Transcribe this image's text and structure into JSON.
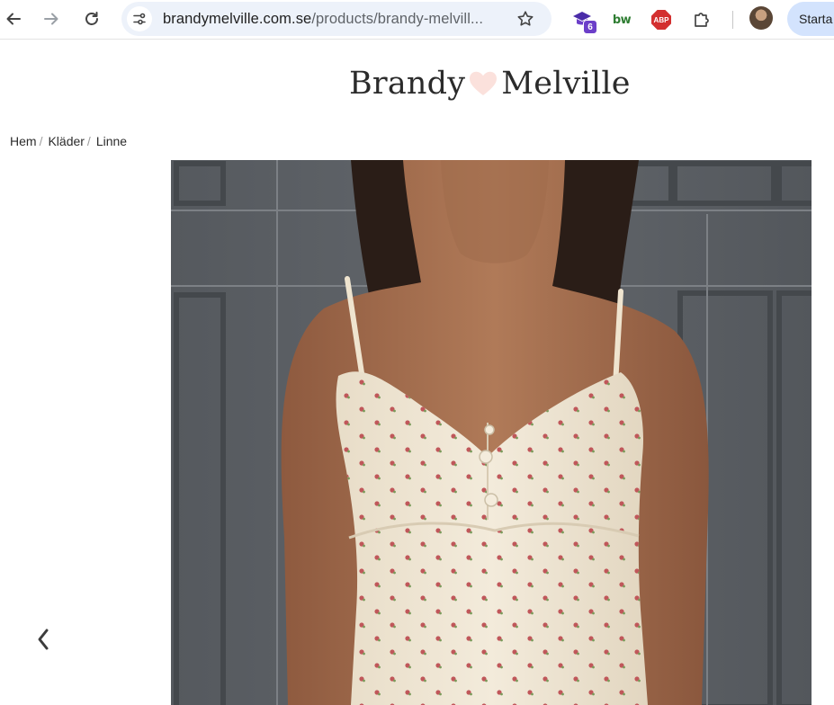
{
  "browser": {
    "url_domain": "brandymelville.com.se",
    "url_path": "/products/brandy-melvill...",
    "extension_badge": "6",
    "extension_bw": "bw",
    "extension_abp": "ABP",
    "start_button": "Starta"
  },
  "brand": {
    "name_left": "Brandy",
    "name_right": "Melville",
    "heart_color": "#fbe1dc"
  },
  "breadcrumb": {
    "items": [
      "Hem",
      "Kläder",
      "Linne"
    ],
    "separator": "/"
  },
  "gallery": {
    "prev_icon": "chevron-left-icon"
  },
  "colors": {
    "omnibox_bg": "#edf2fa",
    "start_button_bg": "#d3e3fd",
    "door_gray": "#5d6166"
  }
}
